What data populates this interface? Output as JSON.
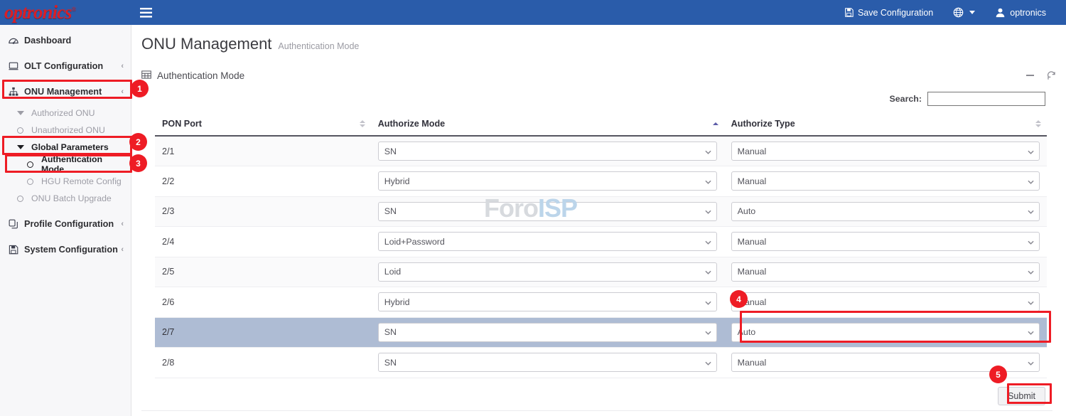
{
  "topbar": {
    "logo_text": "optronics",
    "logo_trademark": "®",
    "menu_icon": "hamburger-icon",
    "save_config_label": "Save Configuration",
    "save_icon": "save-icon",
    "language_icon": "globe-icon",
    "user_icon": "user-icon",
    "username": "optronics"
  },
  "sidebar": {
    "items": [
      {
        "label": "Dashboard",
        "icon": "dashboard-icon",
        "chevron": "",
        "type": "top"
      },
      {
        "label": "OLT Configuration",
        "icon": "monitor-icon",
        "chevron": "‹",
        "type": "top"
      },
      {
        "label": "ONU Management",
        "icon": "sitemap-icon",
        "chevron": "‹",
        "type": "top"
      },
      {
        "label": "Authorized ONU",
        "icon": "chevron-down-icon",
        "type": "sub"
      },
      {
        "label": "Unauthorized ONU",
        "icon": "circle-icon",
        "type": "sub"
      },
      {
        "label": "Global Parameters",
        "icon": "chevron-down-icon",
        "type": "sub-bold"
      },
      {
        "label": "Authentication Mode",
        "icon": "circle-icon",
        "type": "sub2-active"
      },
      {
        "label": "HGU Remote Config",
        "icon": "circle-icon",
        "type": "sub2"
      },
      {
        "label": "ONU Batch Upgrade",
        "icon": "circle-icon",
        "type": "sub"
      },
      {
        "label": "Profile Configuration",
        "icon": "copy-icon",
        "chevron": "‹",
        "type": "top"
      },
      {
        "label": "System Configuration",
        "icon": "save-icon",
        "chevron": "‹",
        "type": "top"
      }
    ]
  },
  "page": {
    "title": "ONU Management",
    "subtitle": "Authentication Mode"
  },
  "panel": {
    "title": "Authentication Mode",
    "title_icon": "table-icon",
    "minimize_icon": "minimize-icon",
    "refresh_icon": "refresh-icon"
  },
  "search": {
    "label": "Search:",
    "value": "",
    "placeholder": ""
  },
  "table": {
    "columns": [
      {
        "label": "PON Port",
        "sort": "none"
      },
      {
        "label": "Authorize Mode",
        "sort": "asc"
      },
      {
        "label": "Authorize Type",
        "sort": "none"
      }
    ],
    "rows": [
      {
        "pon_port": "2/1",
        "authorize_mode": "SN",
        "authorize_type": "Manual",
        "selected": false
      },
      {
        "pon_port": "2/2",
        "authorize_mode": "Hybrid",
        "authorize_type": "Manual",
        "selected": false
      },
      {
        "pon_port": "2/3",
        "authorize_mode": "SN",
        "authorize_type": "Auto",
        "selected": false
      },
      {
        "pon_port": "2/4",
        "authorize_mode": "Loid+Password",
        "authorize_type": "Manual",
        "selected": false
      },
      {
        "pon_port": "2/5",
        "authorize_mode": "Loid",
        "authorize_type": "Manual",
        "selected": false
      },
      {
        "pon_port": "2/6",
        "authorize_mode": "Hybrid",
        "authorize_type": "Manual",
        "selected": false
      },
      {
        "pon_port": "2/7",
        "authorize_mode": "SN",
        "authorize_type": "Auto",
        "selected": true
      },
      {
        "pon_port": "2/8",
        "authorize_mode": "SN",
        "authorize_type": "Manual",
        "selected": false
      }
    ]
  },
  "actions": {
    "submit_label": "Submit"
  },
  "watermark": {
    "part1": "Foro",
    "part2": "ISP"
  },
  "annotations": {
    "badges": [
      "1",
      "2",
      "3",
      "4",
      "5"
    ],
    "color": "#ee1c25"
  }
}
